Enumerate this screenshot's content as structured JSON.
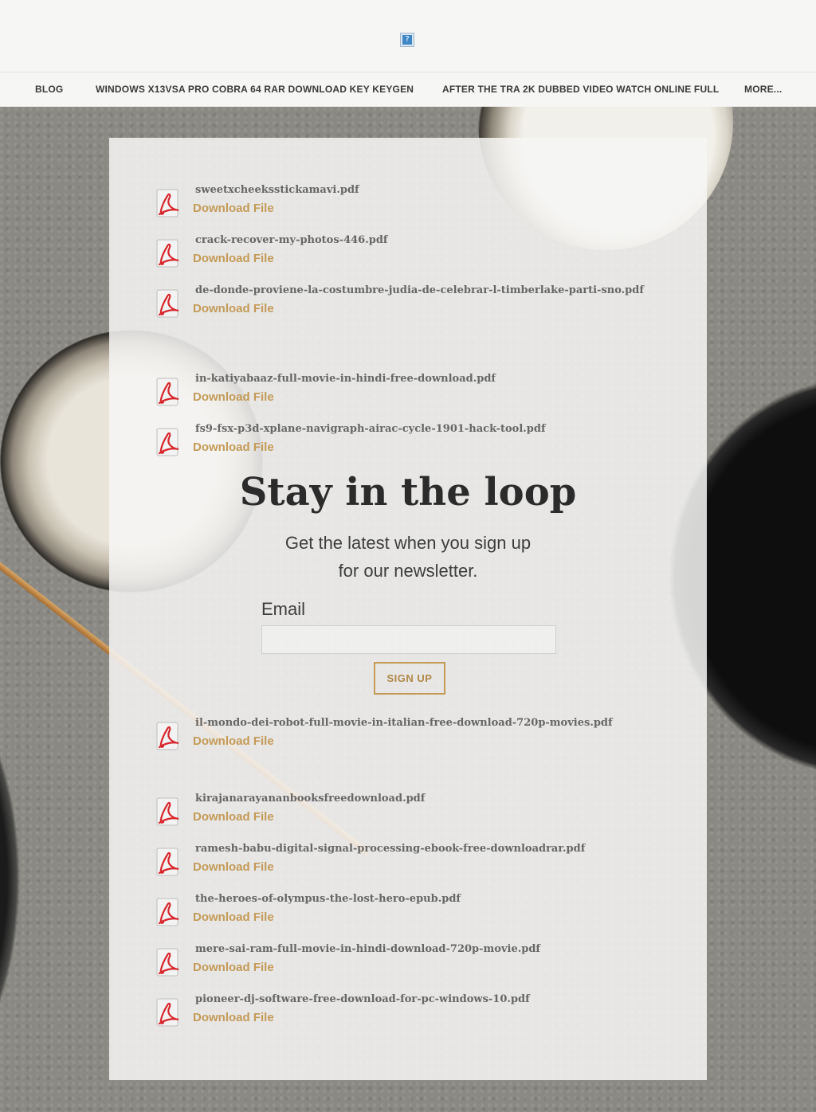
{
  "header": {
    "logo_icon": "broken-image-icon",
    "logo_glyph": "?"
  },
  "nav": {
    "items": [
      {
        "label": "BLOG"
      },
      {
        "label": "WINDOWS X13VSA PRO COBRA 64 RAR DOWNLOAD KEY KEYGEN"
      },
      {
        "label": "AFTER THE TRA 2K DUBBED VIDEO WATCH ONLINE FULL"
      },
      {
        "label": "MORE..."
      }
    ]
  },
  "files": [
    {
      "name": "sweetxcheeksstickamavi.pdf",
      "link": "Download File"
    },
    {
      "name": "crack-recover-my-photos-446.pdf",
      "link": "Download File"
    },
    {
      "name": "de-donde-proviene-la-costumbre-judia-de-celebrar-l-timberlake-parti-sno.pdf",
      "link": "Download File"
    },
    {
      "name": "in-katiyabaaz-full-movie-in-hindi-free-download.pdf",
      "link": "Download File"
    },
    {
      "name": "fs9-fsx-p3d-xplane-navigraph-airac-cycle-1901-hack-tool.pdf",
      "link": "Download File"
    },
    {
      "name": "il-mondo-dei-robot-full-movie-in-italian-free-download-720p-movies.pdf",
      "link": "Download File"
    },
    {
      "name": "kirajanarayananbooksfreedownload.pdf",
      "link": "Download File"
    },
    {
      "name": "ramesh-babu-digital-signal-processing-ebook-free-downloadrar.pdf",
      "link": "Download File"
    },
    {
      "name": "the-heroes-of-olympus-the-lost-hero-epub.pdf",
      "link": "Download File"
    },
    {
      "name": "mere-sai-ram-full-movie-in-hindi-download-720p-movie.pdf",
      "link": "Download File"
    },
    {
      "name": "pioneer-dj-software-free-download-for-pc-windows-10.pdf",
      "link": "Download File"
    }
  ],
  "newsletter": {
    "title": "Stay in the loop",
    "subtitle_line1": "Get the latest when you sign up",
    "subtitle_line2": "for our newsletter.",
    "email_label": "Email",
    "email_value": "",
    "button_label": "SIGN UP"
  },
  "colors": {
    "accent": "#c49a57",
    "pdf_red": "#d8262c",
    "header_bg": "#f6f6f5",
    "text_dark": "#2b2b2b"
  }
}
